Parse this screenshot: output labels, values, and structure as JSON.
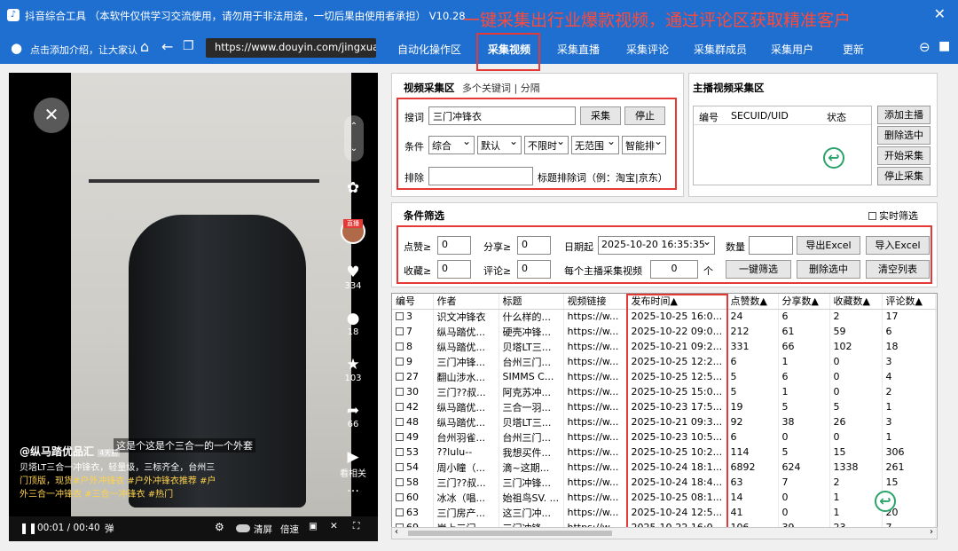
{
  "titlebar": {
    "app_title": "抖音综合工具 （本软件仅供学习交流使用，请勿用于非法用途，一切后果由使用者承担） V10.28",
    "promo": "一键采集出行业爆款视频，通过评论区获取精准客户",
    "close": "✕"
  },
  "navbar": {
    "user_label": "点击添加介绍，让大家认",
    "url": "https://www.douyin.com/jingxuan",
    "tabs": [
      "自动化操作区",
      "采集视频",
      "采集直播",
      "采集评论",
      "采集群成员",
      "采集用户",
      "更新"
    ],
    "active_tab": "采集视频"
  },
  "video": {
    "side_counts": {
      "likes": "334",
      "comments": "18",
      "favorites": "103",
      "shares": "66",
      "related": "看相关"
    },
    "author": "@纵马踏优品汇",
    "author_tag": "4天前",
    "caption_lines": [
      "贝塔LT三合一冲锋衣，轻量级，三标齐全，台州三",
      "门顶版，现货#户外冲锋衣 #户外冲锋衣推荐 #户",
      "外三合一冲锋衣 #三合一冲锋衣 #热门"
    ],
    "subtitle": "这是个这是个三合一的一个外套",
    "time": "00:01 / 00:40",
    "ctrl_labels": {
      "quality": "清屏",
      "speed": "倍速",
      "avatar_tag": "直播"
    }
  },
  "video_collect": {
    "title": "视频采集区",
    "tabs": [
      "多个关键词",
      "分隔"
    ],
    "tab_sep": "|",
    "keyword_label": "搜词",
    "keyword_value": "三门冲锋衣",
    "collect_btn": "采集",
    "stop_btn": "停止",
    "cond_label": "条件",
    "conditions": [
      "综合",
      "默认",
      "不限时",
      "无范围",
      "智能排"
    ],
    "exclude_label": "排除",
    "exclude_value": "",
    "exclude_hint": "标题排除词（例：淘宝|京东）"
  },
  "anchor_collect": {
    "title": "主播视频采集区",
    "columns": [
      "编号",
      "SECUID/UID",
      "状态"
    ],
    "buttons": [
      "添加主播",
      "删除选中",
      "开始采集",
      "停止采集"
    ]
  },
  "filter": {
    "title": "条件筛选",
    "realtime_label": "实时筛选",
    "likes_label": "点赞≥",
    "likes": "0",
    "shares_label": "分享≥",
    "shares": "0",
    "date_label": "日期起",
    "date": "2025-10-20 16:35:35",
    "qty_label": "数量",
    "qty": "",
    "fav_label": "收藏≥",
    "fav": "0",
    "comments_label": "评论≥",
    "comments": "0",
    "per_anchor_label": "每个主播采集视频",
    "per_anchor": "0",
    "per_anchor_unit": "个",
    "buttons": {
      "export": "导出Excel",
      "import": "导入Excel",
      "filter": "一键筛选",
      "delete": "删除选中",
      "clear": "清空列表"
    }
  },
  "table": {
    "columns": [
      "编号",
      "作者",
      "标题",
      "视频链接",
      "发布时间▲",
      "点赞数▲",
      "分享数▲",
      "收藏数▲",
      "评论数▲"
    ],
    "rows": [
      [
        "3",
        "识文冲锋衣",
        "什么样的...",
        "https://w...",
        "2025-10-25 16:0...",
        "24",
        "6",
        "2",
        "17"
      ],
      [
        "7",
        "纵马踏优...",
        "硬壳冲锋...",
        "https://w...",
        "2025-10-22 09:0...",
        "212",
        "61",
        "59",
        "6"
      ],
      [
        "8",
        "纵马踏优...",
        "贝塔LT三...",
        "https://w...",
        "2025-10-21 09:2...",
        "331",
        "66",
        "102",
        "18"
      ],
      [
        "9",
        "三门冲锋...",
        "台州三门...",
        "https://w...",
        "2025-10-25 12:2...",
        "6",
        "1",
        "0",
        "3"
      ],
      [
        "27",
        "翻山涉水...",
        "SIMMS C...",
        "https://w...",
        "2025-10-25 12:5...",
        "5",
        "6",
        "0",
        "4"
      ],
      [
        "30",
        "三门??叔...",
        "阿克苏冲...",
        "https://w...",
        "2025-10-25 15:0...",
        "5",
        "1",
        "0",
        "2"
      ],
      [
        "42",
        "纵马踏优...",
        "三合一羽...",
        "https://w...",
        "2025-10-23 17:5...",
        "19",
        "5",
        "5",
        "1"
      ],
      [
        "48",
        "纵马踏优...",
        "贝塔LT三...",
        "https://w...",
        "2025-10-21 09:3...",
        "92",
        "38",
        "26",
        "3"
      ],
      [
        "49",
        "台州羽雀...",
        "台州三门...",
        "https://w...",
        "2025-10-23 10:5...",
        "6",
        "0",
        "0",
        "1"
      ],
      [
        "53",
        "??lulu--",
        "我想买件...",
        "https://w...",
        "2025-10-25 10:2...",
        "114",
        "5",
        "15",
        "306"
      ],
      [
        "54",
        "周小瞳（...",
        "滴~这期...",
        "https://w...",
        "2025-10-24 18:1...",
        "6892",
        "624",
        "1338",
        "261"
      ],
      [
        "58",
        "三门??叔...",
        "三门冲锋...",
        "https://w...",
        "2025-10-24 18:4...",
        "63",
        "7",
        "2",
        "15"
      ],
      [
        "60",
        "冰冰（唱...",
        "始祖鸟SV. ...",
        "https://w...",
        "2025-10-25 08:1...",
        "14",
        "0",
        "1",
        "2"
      ],
      [
        "63",
        "三门房产...",
        "这三门冲...",
        "https://w...",
        "2025-10-24 12:5...",
        "41",
        "0",
        "1",
        "20"
      ],
      [
        "69",
        "岸上三门",
        "三门冲锋...",
        "https://w...",
        "2025-10-22 16:0...",
        "106",
        "39",
        "23",
        "7"
      ]
    ]
  },
  "colors": {
    "titlebar": "#1f6fd1",
    "highlight": "#e53935",
    "promo": "#ff4a3a",
    "badge": "#2aa36a"
  }
}
